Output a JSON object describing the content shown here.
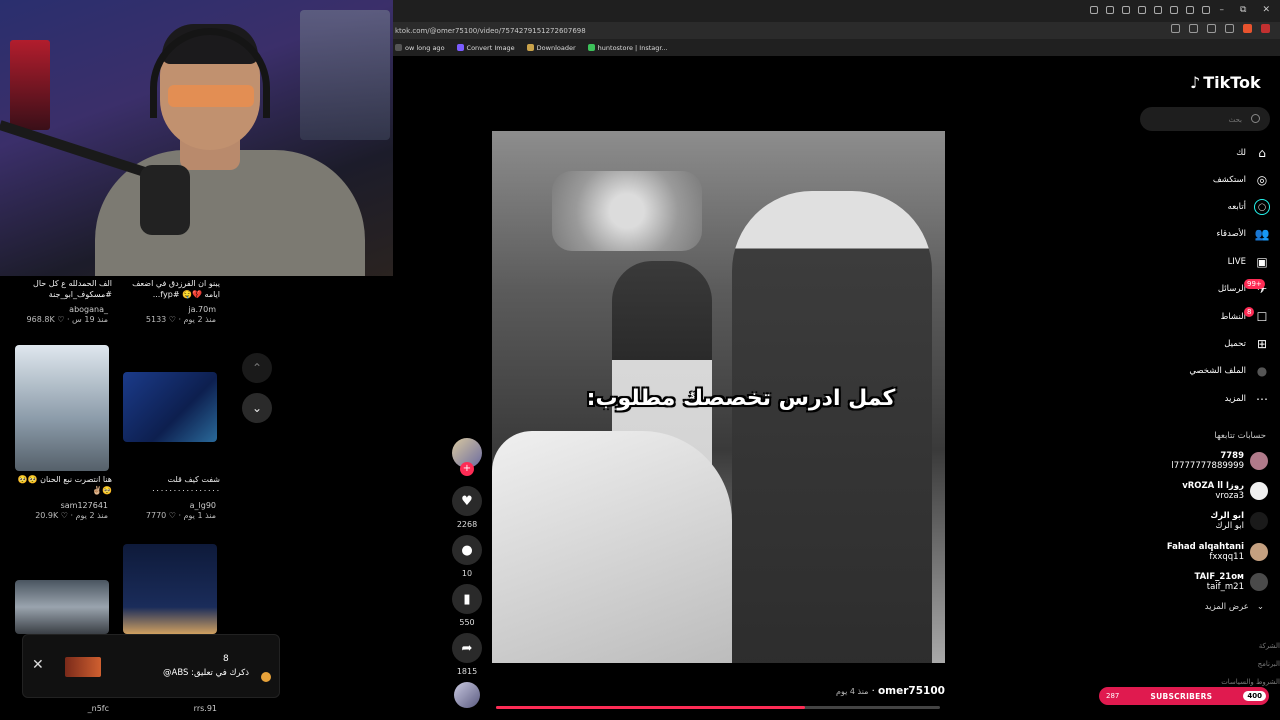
{
  "browser": {
    "url": "ktok.com/@omer75100/video/7574279151272607698",
    "bookmarks": [
      {
        "label": "ow long ago",
        "color": "#555555"
      },
      {
        "label": "Convert Image",
        "color": "#7b5cff"
      },
      {
        "label": "Downloader",
        "color": "#c9a24a"
      },
      {
        "label": "huntostore | Instagr...",
        "color": "#3cc15a"
      }
    ],
    "window_controls": [
      "–",
      "⧉",
      "✕"
    ]
  },
  "left_grid": {
    "cards": [
      {
        "caption": "الف الحمدلله ع كل حال #مسكوف_ابو_جنة",
        "author": "abogana_",
        "meta": "968.8K ♡  · منذ 19 س"
      },
      {
        "caption": "يبنو ان الفرزدق في اضعف ايامه 💔🤤 #fyp...",
        "author": "ja.70m",
        "meta": "5133 ♡  · منذ 2 يوم"
      },
      {
        "caption": "هنا انتصرت نبع الحنان 🥺🥺🥺✌🏼",
        "author": "sam127641",
        "meta": "20.9K ♡  · منذ 2 يوم"
      },
      {
        "caption": "شفت كيف قلت ٠٠٠٠٠٠٠٠٠٠٠٠٠٠٠٠",
        "author": "a_lg90",
        "meta": "7770 ♡  · منذ 1 يوم"
      },
      {
        "caption": "",
        "author": "_n5fc",
        "meta": ""
      },
      {
        "caption": "",
        "author": "rrs.91",
        "meta": ""
      }
    ]
  },
  "nav_arrows": {
    "up": "⌃",
    "down": "⌄"
  },
  "toast": {
    "close": "✕",
    "count": "8",
    "text": "ذكرك في تعليق: ABS@"
  },
  "video": {
    "caption": "كمل ادرس تخصصك مطلوب:",
    "progress": 0.696,
    "author": "omer75100",
    "time": "منذ 4 يوم"
  },
  "actions": {
    "likes": "2268",
    "comments": "10",
    "saves": "550",
    "shares": "1815"
  },
  "sidebar": {
    "logo": "TikTok",
    "search_placeholder": "بحث",
    "nav": [
      {
        "label": "لك",
        "icon": "home-icon",
        "glyph": "⌂"
      },
      {
        "label": "استكشف",
        "icon": "compass-icon",
        "glyph": "◎"
      },
      {
        "label": "أتابعه",
        "icon": "following-avatar-icon",
        "glyph": "◯"
      },
      {
        "label": "الأصدقاء",
        "icon": "friends-icon",
        "glyph": "👥"
      },
      {
        "label": "LIVE",
        "icon": "live-icon",
        "glyph": "▣"
      },
      {
        "label": "الرسائل",
        "icon": "messages-icon",
        "glyph": "✈"
      },
      {
        "label": "النشاط",
        "icon": "activity-icon",
        "glyph": "☐"
      },
      {
        "label": "تحميل",
        "icon": "upload-icon",
        "glyph": "⊞"
      },
      {
        "label": "الملف الشخصي",
        "icon": "profile-avatar-icon",
        "glyph": "●"
      },
      {
        "label": "المزيد",
        "icon": "more-icon",
        "glyph": "⋯"
      }
    ],
    "messages_badge": "99+",
    "activity_badge": "8",
    "following_title": "حسابات تتابعها",
    "accounts": [
      {
        "name": "7789",
        "handle": "l7777777889999",
        "color": "#b07a8a"
      },
      {
        "name": "vROZA ll روزا",
        "handle": "vroza3",
        "color": "#f0f0f0"
      },
      {
        "name": "ابو الرك",
        "handle": "ابو الرك",
        "color": "#1a1a1a"
      },
      {
        "name": "Fahad alqahtani",
        "handle": "fxxqq11",
        "color": "#c4a080"
      },
      {
        "name": "TAIF_21ᴏᴍ",
        "handle": "taif_m21",
        "color": "#4a4a4a"
      }
    ],
    "see_more": "عرض المزيد",
    "footer": [
      "الشركة",
      "البرنامج",
      "الشروط والسياسات"
    ],
    "subscribers": {
      "left": "287",
      "label": "SUBSCRIBERS",
      "right": "400"
    },
    "footer_brand": "TikTok"
  },
  "colors": {
    "accent": "#fe2c55",
    "background": "#000000",
    "panel": "#1e1e1e"
  }
}
